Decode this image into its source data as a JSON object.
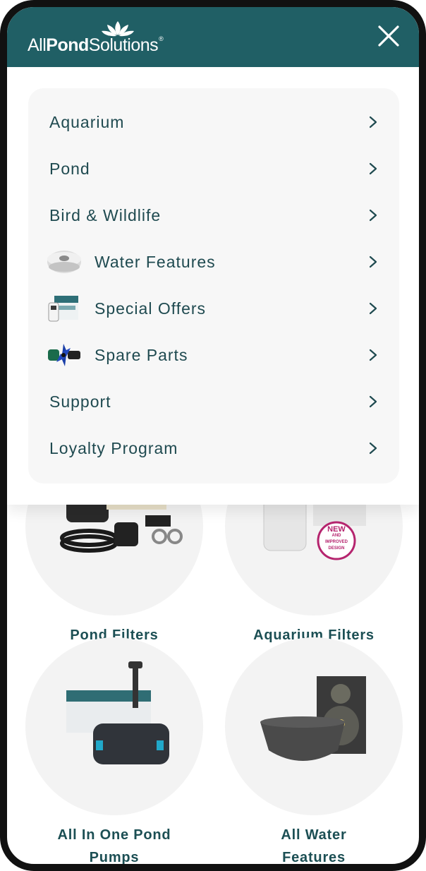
{
  "header": {
    "brand_part1": "All",
    "brand_part2": "Pond",
    "brand_part3": "Solutions",
    "brand_tm": "®",
    "icons": {
      "close": "close-icon",
      "logo": "lotus-logo-icon"
    },
    "colors": {
      "header_bg": "#205f65",
      "text": "#ffffff"
    }
  },
  "menu": {
    "items": [
      {
        "label": "Aquarium",
        "thumb": null
      },
      {
        "label": "Pond",
        "thumb": null
      },
      {
        "label": "Bird & Wildlife",
        "thumb": null
      },
      {
        "label": "Water Features",
        "thumb": "water-feature-bowl-image"
      },
      {
        "label": "Special Offers",
        "thumb": "boxed-filter-image"
      },
      {
        "label": "Spare Parts",
        "thumb": "impeller-part-image"
      },
      {
        "label": "Support",
        "thumb": null
      },
      {
        "label": "Loyalty Program",
        "thumb": null
      }
    ],
    "chevron_icon": "chevron-right-icon",
    "colors": {
      "card_bg": "#f7f7f7",
      "text": "#1f4a50"
    }
  },
  "categories": [
    {
      "label": "Pond Filters"
    },
    {
      "label": "Aquarium Filters",
      "badge_line1": "NEW",
      "badge_line2": "AND",
      "badge_line3": "IMPROVED",
      "badge_line4": "DESIGN"
    },
    {
      "label_line1": "All In One Pond",
      "label_line2": "Pumps"
    },
    {
      "label_line1": "All Water",
      "label_line2": "Features"
    }
  ]
}
